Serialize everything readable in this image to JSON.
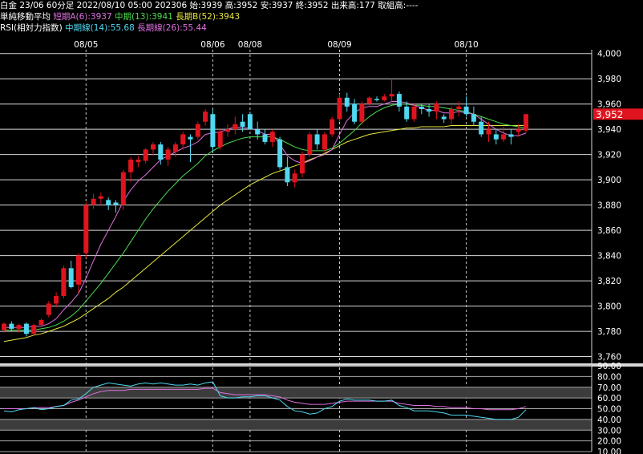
{
  "header": {
    "line1": "白金 23/06 60分足 2022/08/10 05:00 202306 始:3939 高:3952 安:3937 終:3952 出来高:177 取組高:----",
    "ma_title": "単純移動平均",
    "ma_short": "短期A(6):3937",
    "ma_mid": "中期(13):3941",
    "ma_long": "長期B(52):3943",
    "rsi_title": "RSI(相対力指数)",
    "rsi_mid": "中期線(14):55.68",
    "rsi_long": "長期線(26):55.44"
  },
  "colors": {
    "up": "#e0141e",
    "down": "#50d8f0",
    "ma_short": "#e070e0",
    "ma_mid": "#4cdc4c",
    "ma_long": "#e6e640",
    "rsi_mid": "#50d8f0",
    "rsi_long": "#e070e0",
    "price_tag": "#e0141e"
  },
  "chart_data": [
    {
      "type": "candlestick",
      "x_labels": [
        {
          "label": "08/05",
          "index": 11
        },
        {
          "label": "08/06",
          "index": 28
        },
        {
          "label": "08/08",
          "index": 33
        },
        {
          "label": "08/09",
          "index": 45
        },
        {
          "label": "08/10",
          "index": 62
        }
      ],
      "y_ticks": [
        "4,000",
        "3,980",
        "3,960",
        "3,940",
        "3,920",
        "3,900",
        "3,880",
        "3,860",
        "3,840",
        "3,820",
        "3,800",
        "3,780",
        "3,760"
      ],
      "ylim": [
        3754,
        4003
      ],
      "last_price_label": "3,952",
      "last_price": 3952,
      "candles": [
        [
          3781,
          3787,
          3779,
          3786
        ],
        [
          3786,
          3788,
          3780,
          3782
        ],
        [
          3782,
          3786,
          3779,
          3785
        ],
        [
          3786,
          3787,
          3776,
          3778
        ],
        [
          3778,
          3786,
          3777,
          3785
        ],
        [
          3785,
          3790,
          3784,
          3789
        ],
        [
          3793,
          3804,
          3791,
          3802
        ],
        [
          3802,
          3811,
          3799,
          3808
        ],
        [
          3808,
          3832,
          3806,
          3830
        ],
        [
          3830,
          3836,
          3814,
          3815
        ],
        [
          3817,
          3842,
          3810,
          3840
        ],
        [
          3842,
          3882,
          3838,
          3880
        ],
        [
          3880,
          3889,
          3877,
          3885
        ],
        [
          3885,
          3890,
          3880,
          3887
        ],
        [
          3884,
          3886,
          3876,
          3880
        ],
        [
          3882,
          3884,
          3874,
          3880
        ],
        [
          3880,
          3908,
          3876,
          3906
        ],
        [
          3906,
          3918,
          3898,
          3916
        ],
        [
          3914,
          3919,
          3910,
          3916
        ],
        [
          3915,
          3925,
          3913,
          3924
        ],
        [
          3924,
          3930,
          3919,
          3928
        ],
        [
          3928,
          3930,
          3912,
          3916
        ],
        [
          3916,
          3926,
          3911,
          3924
        ],
        [
          3922,
          3930,
          3918,
          3928
        ],
        [
          3928,
          3938,
          3924,
          3936
        ],
        [
          3934,
          3936,
          3914,
          3932
        ],
        [
          3934,
          3946,
          3932,
          3944
        ],
        [
          3946,
          3956,
          3943,
          3954
        ],
        [
          3952,
          3956,
          3922,
          3926
        ],
        [
          3926,
          3940,
          3924,
          3938
        ],
        [
          3938,
          3944,
          3934,
          3940
        ],
        [
          3940,
          3950,
          3936,
          3944
        ],
        [
          3946,
          3952,
          3938,
          3942
        ],
        [
          3952,
          3954,
          3940,
          3940
        ],
        [
          3940,
          3946,
          3932,
          3936
        ],
        [
          3936,
          3940,
          3928,
          3930
        ],
        [
          3930,
          3940,
          3926,
          3938
        ],
        [
          3932,
          3934,
          3908,
          3910
        ],
        [
          3910,
          3918,
          3895,
          3898
        ],
        [
          3898,
          3908,
          3894,
          3905
        ],
        [
          3905,
          3922,
          3902,
          3920
        ],
        [
          3920,
          3938,
          3918,
          3936
        ],
        [
          3936,
          3940,
          3924,
          3928
        ],
        [
          3924,
          3938,
          3922,
          3936
        ],
        [
          3936,
          3950,
          3934,
          3948
        ],
        [
          3948,
          3968,
          3946,
          3965
        ],
        [
          3965,
          3969,
          3954,
          3958
        ],
        [
          3960,
          3964,
          3944,
          3946
        ],
        [
          3946,
          3962,
          3944,
          3960
        ],
        [
          3960,
          3966,
          3958,
          3965
        ],
        [
          3964,
          3966,
          3962,
          3963
        ],
        [
          3963,
          3968,
          3962,
          3966
        ],
        [
          3966,
          3980,
          3962,
          3968
        ],
        [
          3968,
          3970,
          3954,
          3958
        ],
        [
          3958,
          3962,
          3946,
          3948
        ],
        [
          3948,
          3960,
          3946,
          3958
        ],
        [
          3958,
          3960,
          3952,
          3956
        ],
        [
          3956,
          3960,
          3950,
          3954
        ],
        [
          3954,
          3962,
          3948,
          3960
        ],
        [
          3950,
          3952,
          3945,
          3948
        ],
        [
          3948,
          3958,
          3944,
          3956
        ],
        [
          3956,
          3962,
          3950,
          3958
        ],
        [
          3958,
          3966,
          3950,
          3952
        ],
        [
          3952,
          3958,
          3943,
          3946
        ],
        [
          3946,
          3950,
          3934,
          3936
        ],
        [
          3936,
          3946,
          3930,
          3940
        ],
        [
          3936,
          3940,
          3928,
          3932
        ],
        [
          3932,
          3942,
          3930,
          3936
        ],
        [
          3936,
          3940,
          3928,
          3934
        ],
        [
          3938,
          3944,
          3934,
          3940
        ],
        [
          3939,
          3952,
          3937,
          3952
        ]
      ],
      "ma_short": [
        3783,
        3783,
        3783,
        3783,
        3784,
        3784,
        3786,
        3790,
        3797,
        3803,
        3810,
        3822,
        3836,
        3849,
        3860,
        3871,
        3883,
        3892,
        3899,
        3904,
        3910,
        3916,
        3919,
        3922,
        3925,
        3927,
        3930,
        3936,
        3937,
        3938,
        3940,
        3942,
        3941,
        3941,
        3939,
        3936,
        3936,
        3928,
        3919,
        3915,
        3913,
        3915,
        3918,
        3920,
        3924,
        3936,
        3947,
        3953,
        3957,
        3958,
        3958,
        3960,
        3962,
        3962,
        3961,
        3959,
        3957,
        3955,
        3955,
        3953,
        3953,
        3954,
        3953,
        3952,
        3948,
        3944,
        3940,
        3937,
        3935,
        3935,
        3937
      ],
      "ma_mid": [
        3781,
        3781,
        3781,
        3781,
        3781,
        3782,
        3783,
        3785,
        3788,
        3792,
        3797,
        3804,
        3811,
        3818,
        3826,
        3834,
        3842,
        3851,
        3860,
        3869,
        3877,
        3884,
        3891,
        3897,
        3903,
        3908,
        3913,
        3919,
        3923,
        3926,
        3929,
        3931,
        3933,
        3934,
        3934,
        3934,
        3934,
        3932,
        3929,
        3926,
        3924,
        3923,
        3923,
        3923,
        3925,
        3929,
        3934,
        3939,
        3945,
        3950,
        3954,
        3957,
        3959,
        3960,
        3960,
        3959,
        3959,
        3958,
        3958,
        3957,
        3956,
        3955,
        3954,
        3952,
        3950,
        3948,
        3946,
        3944,
        3943,
        3942,
        3941
      ],
      "ma_long": [
        3772,
        3773,
        3774,
        3775,
        3777,
        3778,
        3780,
        3782,
        3784,
        3787,
        3790,
        3794,
        3798,
        3802,
        3806,
        3811,
        3815,
        3820,
        3825,
        3830,
        3835,
        3840,
        3845,
        3850,
        3855,
        3860,
        3865,
        3870,
        3875,
        3880,
        3884,
        3888,
        3892,
        3896,
        3899,
        3902,
        3905,
        3907,
        3909,
        3911,
        3913,
        3916,
        3918,
        3921,
        3924,
        3927,
        3930,
        3932,
        3934,
        3936,
        3937,
        3938,
        3939,
        3940,
        3941,
        3941,
        3942,
        3942,
        3942,
        3942,
        3943,
        3943,
        3943,
        3943,
        3943,
        3943,
        3943,
        3943,
        3943,
        3943,
        3943
      ]
    },
    {
      "type": "line",
      "title": "RSI",
      "y_ticks": [
        "90.00",
        "80.00",
        "70.00",
        "60.00",
        "50.00",
        "40.00",
        "30.00",
        "20.00",
        "10.00"
      ],
      "ylim": [
        10,
        90
      ],
      "bands": [
        [
          30,
          40
        ],
        [
          60,
          70
        ]
      ],
      "series": [
        {
          "name": "中期線(14)",
          "values": [
            48,
            47,
            49,
            50,
            51,
            49,
            50,
            52,
            53,
            58,
            59,
            64,
            70,
            72,
            74,
            73,
            72,
            71,
            73,
            74,
            73,
            74,
            73,
            72,
            72,
            73,
            72,
            74,
            75,
            62,
            60,
            60,
            61,
            61,
            62,
            62,
            60,
            58,
            52,
            48,
            47,
            45,
            46,
            50,
            52,
            57,
            59,
            58,
            58,
            58,
            57,
            57,
            58,
            53,
            51,
            48,
            48,
            48,
            47,
            46,
            44,
            44,
            44,
            43,
            42,
            41,
            40,
            40,
            40,
            42,
            49
          ]
        },
        {
          "name": "長期線(26)",
          "values": [
            50,
            50,
            50,
            50,
            51,
            51,
            51,
            52,
            53,
            56,
            58,
            61,
            64,
            66,
            67,
            67,
            67,
            68,
            68,
            68,
            68,
            68,
            68,
            68,
            68,
            68,
            68,
            69,
            69,
            65,
            64,
            63,
            63,
            63,
            63,
            63,
            62,
            61,
            58,
            56,
            55,
            54,
            54,
            54,
            55,
            56,
            57,
            57,
            57,
            57,
            57,
            57,
            57,
            55,
            54,
            53,
            53,
            53,
            52,
            52,
            51,
            51,
            51,
            50,
            50,
            49,
            49,
            49,
            49,
            50,
            52
          ]
        }
      ]
    }
  ]
}
